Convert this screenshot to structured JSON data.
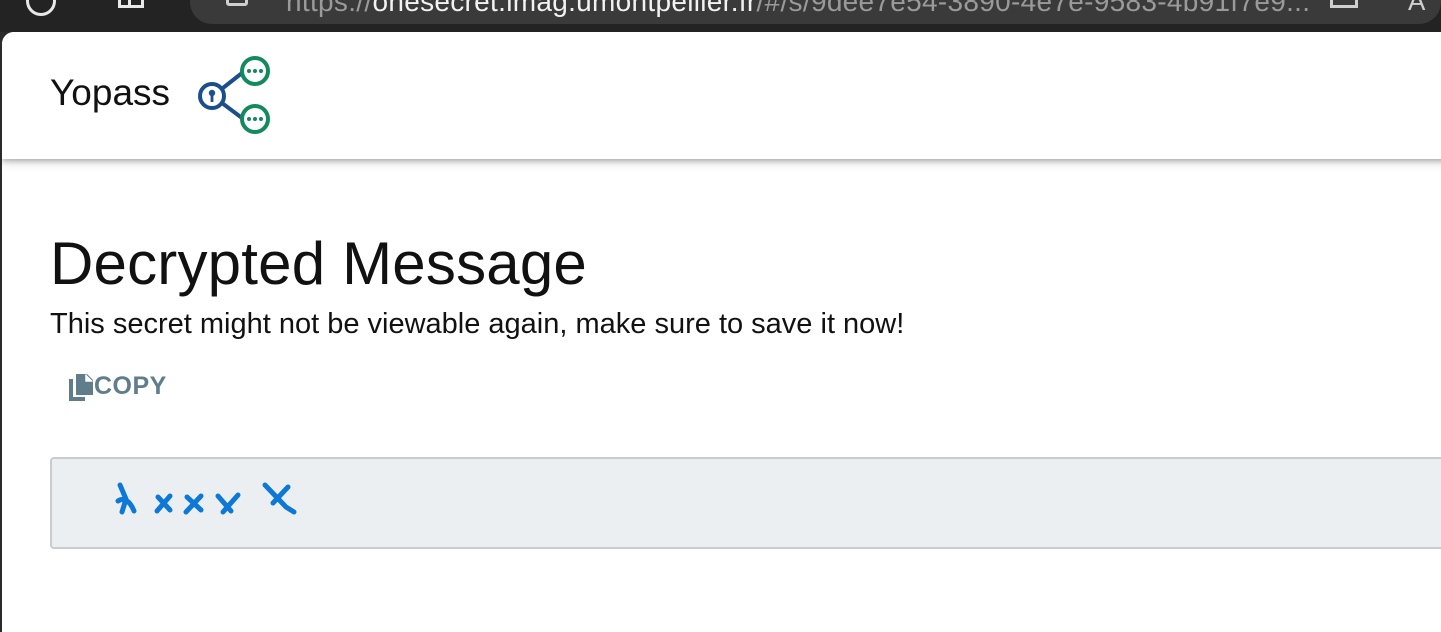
{
  "browser": {
    "url_scheme": "https://",
    "url_host": "onesecret.imag.umontpellier.fr",
    "url_path": "/#/s/9dee7e54-3890-4e7e-9583-4b91f7e9..."
  },
  "header": {
    "brand": "Yopass",
    "logo_icon": "share-lock-icon",
    "colors": {
      "logo_blue": "#1b4f8c",
      "logo_green": "#138a5c"
    }
  },
  "main": {
    "title": "Decrypted Message",
    "subtitle": "This secret might not be viewable again, make sure to save it now!",
    "copy_button": {
      "label": "COPY",
      "icon": "copy-icon",
      "color": "#607d8b"
    },
    "secret": {
      "value": "xxxxx",
      "style": "handwritten-redaction",
      "ink_color": "#0e78d6",
      "background": "#eceff1"
    }
  }
}
